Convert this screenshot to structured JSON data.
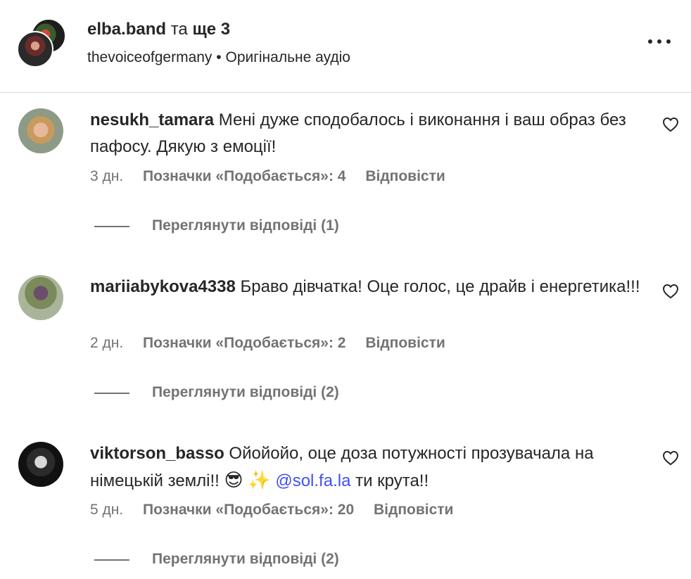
{
  "header": {
    "primary_user": "elba.band",
    "connector": "та",
    "others": "ще 3",
    "subtitle_account": "thevoiceofgermany",
    "separator": "•",
    "audio_label": "Оригінальне аудіо",
    "more_icon": "more-horizontal-icon"
  },
  "comments": [
    {
      "username": "nesukh_tamara",
      "text": "Мені дуже сподобалось і виконання і ваш образ без пафосу. Дякую з емоції!",
      "age": "3 дн.",
      "likes_label": "Позначки «Подобається»: 4",
      "reply_label": "Відповісти",
      "view_replies_label": "Переглянути відповіді (1)"
    },
    {
      "username": "mariiabykova4338",
      "text": "Браво дівчатка! Оце голос, це драйв і енергетика!!!",
      "age": "2 дн.",
      "likes_label": "Позначки «Подобається»: 2",
      "reply_label": "Відповісти",
      "view_replies_label": "Переглянути відповіді (2)"
    },
    {
      "username": "viktorson_basso",
      "text": "Ойойойо, оце доза потужності прозувачала на німецькій землі!!",
      "emoji_1": "😎",
      "emoji_2": "✨",
      "mention": "@sol.fa.la",
      "text_after": "ти крута!!",
      "age": "5 дн.",
      "likes_label": "Позначки «Подобається»: 20",
      "reply_label": "Відповісти",
      "view_replies_label": "Переглянути відповіді (2)"
    }
  ],
  "colors": {
    "text": "#262626",
    "secondary": "#737373",
    "mention": "#4150f7",
    "divider": "#dbdbdb"
  }
}
